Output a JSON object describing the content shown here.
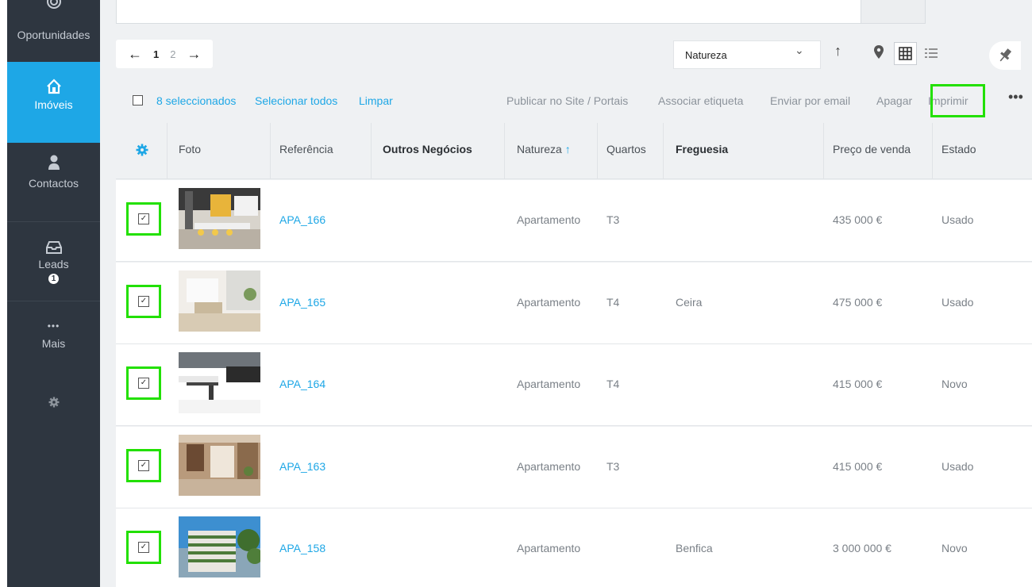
{
  "sidebar": {
    "items": [
      {
        "label": "Oportunidades"
      },
      {
        "label": "Imóveis"
      },
      {
        "label": "Contactos"
      },
      {
        "label": "Leads",
        "badge": "1"
      },
      {
        "label": "Mais"
      }
    ]
  },
  "pager": {
    "pages": [
      "1",
      "2"
    ]
  },
  "sort": {
    "value": "Natureza"
  },
  "bulk": {
    "selected_label": "8 seleccionados",
    "select_all_label": "Selecionar todos",
    "clear_label": "Limpar",
    "actions": [
      "Publicar no Site / Portais",
      "Associar etiqueta",
      "Enviar por email",
      "Apagar",
      "Imprimir"
    ]
  },
  "table": {
    "headers": [
      "Foto",
      "Referência",
      "Outros Negócios",
      "Natureza",
      "Quartos",
      "Freguesia",
      "Preço de venda",
      "Estado"
    ],
    "rows": [
      {
        "ref": "APA_166",
        "natureza": "Apartamento",
        "quartos": "T3",
        "freguesia": "",
        "preco": "435 000 €",
        "estado": "Usado"
      },
      {
        "ref": "APA_165",
        "natureza": "Apartamento",
        "quartos": "T4",
        "freguesia": "Ceira",
        "preco": "475 000 €",
        "estado": "Usado"
      },
      {
        "ref": "APA_164",
        "natureza": "Apartamento",
        "quartos": "T4",
        "freguesia": "",
        "preco": "415 000 €",
        "estado": "Novo"
      },
      {
        "ref": "APA_163",
        "natureza": "Apartamento",
        "quartos": "T3",
        "freguesia": "",
        "preco": "415 000 €",
        "estado": "Usado"
      },
      {
        "ref": "APA_158",
        "natureza": "Apartamento",
        "quartos": "",
        "freguesia": "Benfica",
        "preco": "3 000 000 €",
        "estado": "Novo"
      }
    ]
  },
  "colors": {
    "sidebar_bg": "#2e3640",
    "accent": "#1ea7e6",
    "highlight": "#22e000"
  },
  "icons": [
    "target-icon",
    "home-icon",
    "person-icon",
    "inbox-icon",
    "dots-icon",
    "gear-icon",
    "arrow-left-icon",
    "arrow-right-icon",
    "chevron-down-icon",
    "arrow-up-icon",
    "map-pin-icon",
    "grid-icon",
    "list-icon",
    "pin-icon",
    "more-icon",
    "checkbox-icon"
  ]
}
